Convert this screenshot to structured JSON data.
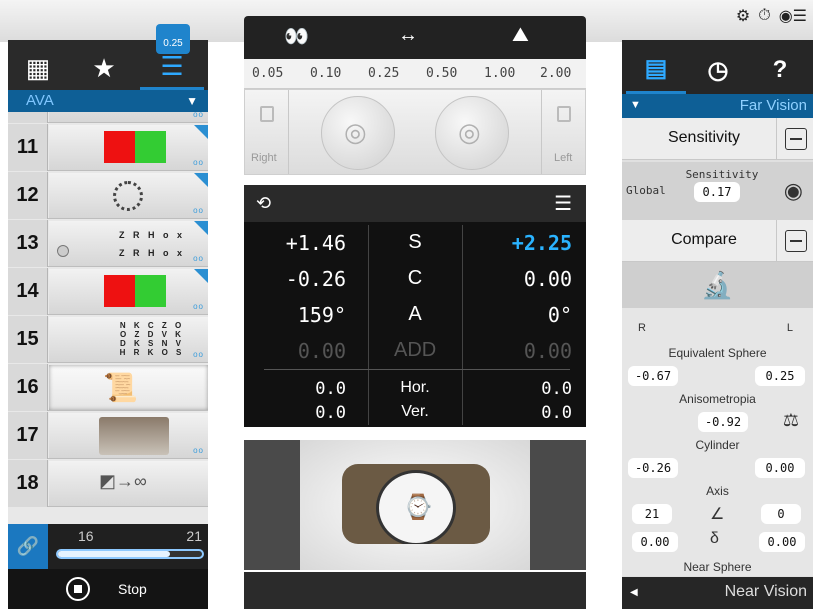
{
  "top_icons": {
    "settings": "gear-icon",
    "timer": "timer-icon",
    "eye_menu": "eye-menu-icon"
  },
  "left_panel": {
    "tabs": [
      {
        "icon": "grid-icon",
        "glyph": "▦"
      },
      {
        "icon": "star-icon",
        "glyph": "★"
      },
      {
        "icon": "list-icon",
        "glyph": "☰"
      }
    ],
    "program": "AVA",
    "tests": [
      {
        "num": "11"
      },
      {
        "num": "12"
      },
      {
        "num": "13",
        "chart_lines": [
          "Z R H o x",
          "Z R H o x"
        ]
      },
      {
        "num": "14"
      },
      {
        "num": "15",
        "chart_lines": [
          "N K C Z O",
          "O Z D V K",
          "D K S N V",
          "H R K O S"
        ]
      },
      {
        "num": "16"
      },
      {
        "num": "17"
      },
      {
        "num": "18",
        "glyph": "◩→∞"
      }
    ],
    "progress": {
      "start": "16",
      "end": "21",
      "fraction": 0.78
    },
    "stop_label": "Stop"
  },
  "center": {
    "scale_labels": [
      "0.05",
      "0.10",
      "0.25",
      "0.50",
      "1.00",
      "2.00"
    ],
    "scale_marker": "0.25",
    "eye_labels": {
      "right": "Right",
      "left": "Left"
    },
    "refraction": {
      "rows": [
        {
          "left": "+1.46",
          "label": "S",
          "right": "+2.25"
        },
        {
          "left": "-0.26",
          "label": "C",
          "right": "0.00"
        },
        {
          "left": "159°",
          "label": "A",
          "right": "0°"
        },
        {
          "left": "0.00",
          "label": "ADD",
          "right": "0.00"
        },
        {
          "left": "0.0",
          "label": "Hor.",
          "right": "0.0"
        },
        {
          "left": "0.0",
          "label": "Ver.",
          "right": "0.0"
        }
      ]
    }
  },
  "right_panel": {
    "tabs": [
      {
        "icon": "patient-record-icon",
        "glyph": "▤"
      },
      {
        "icon": "patient-history-icon",
        "glyph": "◷"
      },
      {
        "icon": "help-icon",
        "glyph": "?"
      }
    ],
    "far_vision": "Far Vision",
    "sensitivity": {
      "header": "Sensitivity",
      "label": "Sensitivity",
      "global_label": "Global",
      "value": "0.17"
    },
    "compare": {
      "header": "Compare",
      "r_label": "R",
      "l_label": "L",
      "equivalent_sphere": {
        "label": "Equivalent Sphere",
        "r": "-0.67",
        "l": "0.25"
      },
      "anisometropia": {
        "label": "Anisometropia",
        "value": "-0.92"
      },
      "cylinder": {
        "label": "Cylinder",
        "r": "-0.26",
        "l": "0.00"
      },
      "axis": {
        "label": "Axis",
        "r": "21",
        "l": "0"
      },
      "delta": {
        "r": "0.00",
        "l": "0.00"
      },
      "near_sphere": "Near Sphere"
    },
    "near_vision": "Near Vision"
  }
}
